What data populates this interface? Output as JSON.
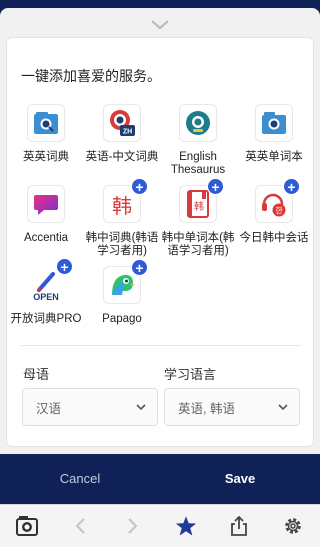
{
  "sheet": {
    "heading": "一键添加喜爱的服务。"
  },
  "services": [
    {
      "label": "英英词典",
      "icon": "book-search-icon",
      "addable": false
    },
    {
      "label": "英语-中文词典",
      "icon": "book-zh-icon",
      "addable": false,
      "badge": "ZH"
    },
    {
      "label": "English Thesaurus",
      "icon": "thesaurus-icon",
      "addable": false
    },
    {
      "label": "英英单词本",
      "icon": "folder-search-icon",
      "addable": false
    },
    {
      "label": "Accentia",
      "icon": "accentia-icon",
      "addable": false
    },
    {
      "label": "韩中词典(韩语学习者用)",
      "icon": "korean-char-icon",
      "addable": true,
      "glyph": "韩"
    },
    {
      "label": "韩中单词本(韩语学习者用)",
      "icon": "korean-notebook-icon",
      "addable": true,
      "glyph": "韩"
    },
    {
      "label": "今日韩中会话",
      "icon": "conversation-icon",
      "addable": true,
      "badge": "한"
    },
    {
      "label": "开放词典PRO",
      "icon": "open-dictionary-icon",
      "addable": true,
      "badge": "OPEN"
    },
    {
      "label": "Papago",
      "icon": "papago-icon",
      "addable": true
    }
  ],
  "languages": {
    "native_label": "母语",
    "native_value": "汉语",
    "learning_label": "学习语言",
    "learning_value": "英语, 韩语"
  },
  "actions": {
    "cancel": "Cancel",
    "save": "Save"
  },
  "toolbar": {
    "items": [
      "dictionary-icon",
      "back-arrow-icon",
      "forward-arrow-icon",
      "star-icon",
      "share-icon",
      "settings-icon"
    ]
  },
  "colors": {
    "navy": "#0f2156",
    "accent_blue": "#2d5bd7",
    "red": "#d93a3a",
    "teal": "#1d7c8c"
  }
}
